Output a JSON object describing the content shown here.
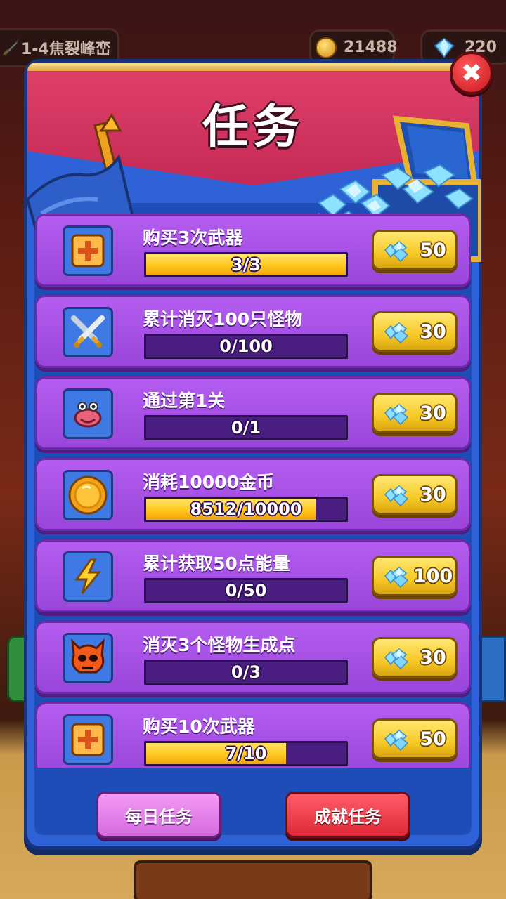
{
  "hud": {
    "level_label": "1-4焦裂峰峦",
    "coins": "21488",
    "gems": "220"
  },
  "dialog": {
    "title": "任务"
  },
  "tasks": [
    {
      "title": "购买3次武器",
      "progress_text": "3/3",
      "progress": 1.0,
      "reward": "50",
      "icon": "plus-icon"
    },
    {
      "title": "累计消灭100只怪物",
      "progress_text": "0/100",
      "progress": 0.0,
      "reward": "30",
      "icon": "crossed-swords-icon"
    },
    {
      "title": "通过第1关",
      "progress_text": "0/1",
      "progress": 0.0,
      "reward": "30",
      "icon": "monster-face-icon"
    },
    {
      "title": "消耗10000金币",
      "progress_text": "8512/10000",
      "progress": 0.8512,
      "reward": "30",
      "icon": "gold-coin-icon"
    },
    {
      "title": "累计获取50点能量",
      "progress_text": "0/50",
      "progress": 0.0,
      "reward": "100",
      "icon": "lightning-icon"
    },
    {
      "title": "消灭3个怪物生成点",
      "progress_text": "0/3",
      "progress": 0.0,
      "reward": "30",
      "icon": "demon-skull-icon"
    },
    {
      "title": "购买10次武器",
      "progress_text": "7/10",
      "progress": 0.7,
      "reward": "50",
      "icon": "plus-icon"
    }
  ],
  "tabs": {
    "daily": "每日任务",
    "achievement": "成就任务"
  },
  "colors": {
    "progress_fill": "#ffc71c",
    "task_card": "#a44fe4",
    "reward_button": "#f7c925",
    "dialog_frame": "#2f62d6",
    "banner": "#d1355f"
  }
}
